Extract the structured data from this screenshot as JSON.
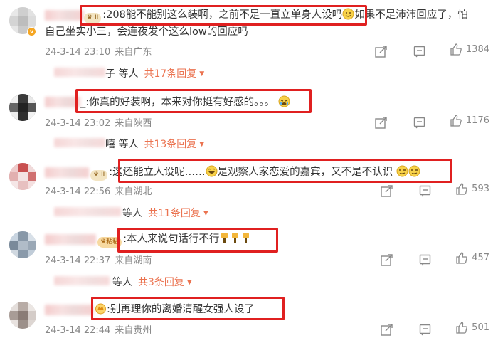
{
  "comments": [
    {
      "text_line1": ":208能不能别这么装啊，之前不是一直立单身人设吗",
      "text_line1b": "如果不是沛沛回应了，怕",
      "text_line2": "自己坐实小三，会连夜发个这么low的回应吗",
      "date": "24-3-14 23:10",
      "location": "来自广东",
      "likes": "1384",
      "badge": "II",
      "reply_suffix": "子",
      "reply_etc": "等人",
      "reply_count": "共17条回复"
    },
    {
      "text_line1": "_:你真的好装啊，本来对你挺有好感的。。。",
      "date": "24-3-14 23:02",
      "location": "来自陕西",
      "likes": "1176",
      "reply_suffix": "嘻",
      "reply_etc": "等人",
      "reply_count": "共13条回复"
    },
    {
      "text_line1": ":这还能立人设呢……",
      "text_line1b": "是观察人家恋爱的嘉宾，又不是不认识",
      "date": "24-3-14 22:56",
      "location": "来自湖北",
      "likes": "593",
      "badge": "II",
      "reply_etc": "等人",
      "reply_count": "共11条回复"
    },
    {
      "text_line1": ":本人来说句话行不行",
      "date": "24-3-14 22:37",
      "location": "来自湖南",
      "likes": "457",
      "badge": "粘粘",
      "reply_etc": "等人",
      "reply_count": "共3条回复"
    },
    {
      "text_line1": ":别再理你的离婚清醒女强人设了",
      "date": "24-3-14 22:44",
      "location": "来自贵州",
      "likes": "501"
    }
  ],
  "icons": {
    "share": "share-icon",
    "comment": "comment-icon",
    "like": "like-icon",
    "caret": "caret-down-icon",
    "verified": "verified-v-icon"
  },
  "colors": {
    "highlight_border": "#e02020",
    "reply_link": "#eb7350",
    "meta_text": "#888888"
  },
  "verified_mark": "v"
}
